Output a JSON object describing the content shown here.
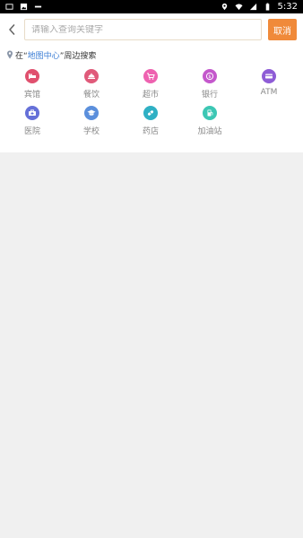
{
  "status_bar": {
    "time": "5:32",
    "left_icons": [
      "screen-icon",
      "image-icon",
      "notification-text-icon"
    ],
    "right_icons": [
      "location-icon",
      "wifi-icon",
      "signal-icon",
      "battery-icon"
    ]
  },
  "search": {
    "placeholder": "请输入查询关键字",
    "value": "",
    "cancel_label": "取消"
  },
  "nearby": {
    "prefix": "在“",
    "link": "地图中心",
    "suffix": "”周边搜索"
  },
  "categories": [
    {
      "label": "宾馆",
      "icon": "bed-icon",
      "color": "#e0506e"
    },
    {
      "label": "餐饮",
      "icon": "dining-icon",
      "color": "#e05a7a"
    },
    {
      "label": "超市",
      "icon": "cart-icon",
      "color": "#ee62b0"
    },
    {
      "label": "银行",
      "icon": "money-icon",
      "color": "#c458cc"
    },
    {
      "label": "ATM",
      "icon": "card-icon",
      "color": "#8e5cd6"
    },
    {
      "label": "医院",
      "icon": "medical-kit-icon",
      "color": "#6570d8"
    },
    {
      "label": "学校",
      "icon": "graduation-cap-icon",
      "color": "#5b8fdc"
    },
    {
      "label": "药店",
      "icon": "pill-icon",
      "color": "#2fb0c4"
    },
    {
      "label": "加油站",
      "icon": "fuel-icon",
      "color": "#3cc7b4"
    }
  ]
}
